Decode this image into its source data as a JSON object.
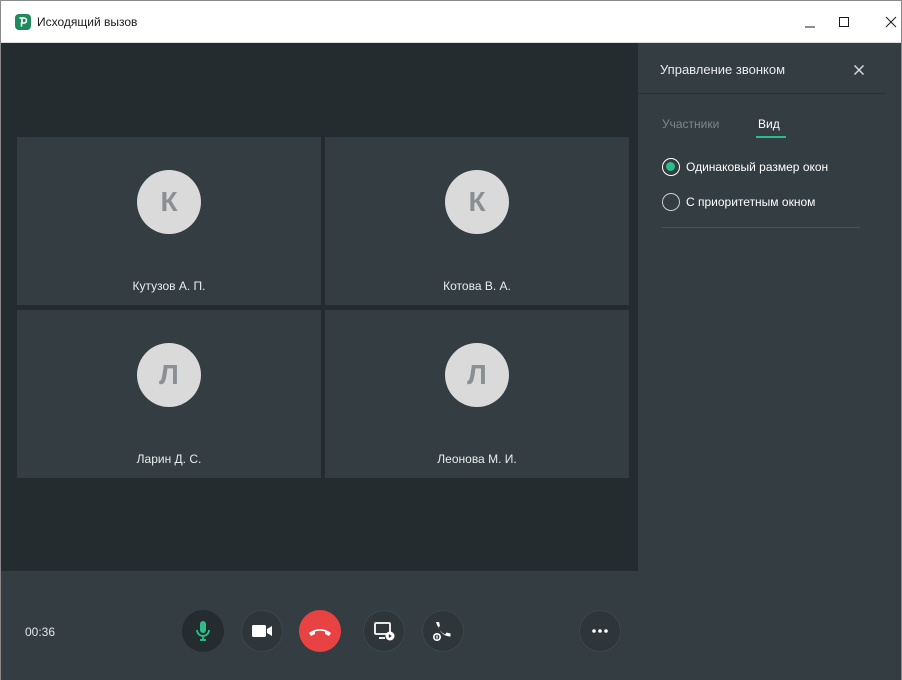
{
  "window": {
    "title": "Исходящий вызов",
    "icon": "app-logo-icon",
    "controls": [
      "minimize-icon",
      "maximize-icon",
      "close-icon"
    ]
  },
  "participants": [
    {
      "initial": "К",
      "name": "Кутузов  А. П."
    },
    {
      "initial": "К",
      "name": "Котова В. А."
    },
    {
      "initial": "Л",
      "name": "Ларин Д. С."
    },
    {
      "initial": "Л",
      "name": "Леонова М. И."
    }
  ],
  "controls": {
    "timer": "00:36",
    "buttons": [
      "microphone-icon",
      "camera-icon",
      "hang-up-icon",
      "screen-share-icon",
      "call-transfer-icon",
      "more-icon"
    ]
  },
  "panel": {
    "title": "Управление звонком",
    "tabs": [
      {
        "label": "Участники",
        "active": false
      },
      {
        "label": "Вид",
        "active": true
      }
    ],
    "layout_options": [
      {
        "label": "Одинаковый размер окон",
        "selected": true
      },
      {
        "label": "С приоритетным окном",
        "selected": false
      }
    ]
  },
  "colors": {
    "accent": "#2bbf87",
    "end_call": "#e94242",
    "panel_bg": "#343d42",
    "video_bg": "#252c30"
  }
}
